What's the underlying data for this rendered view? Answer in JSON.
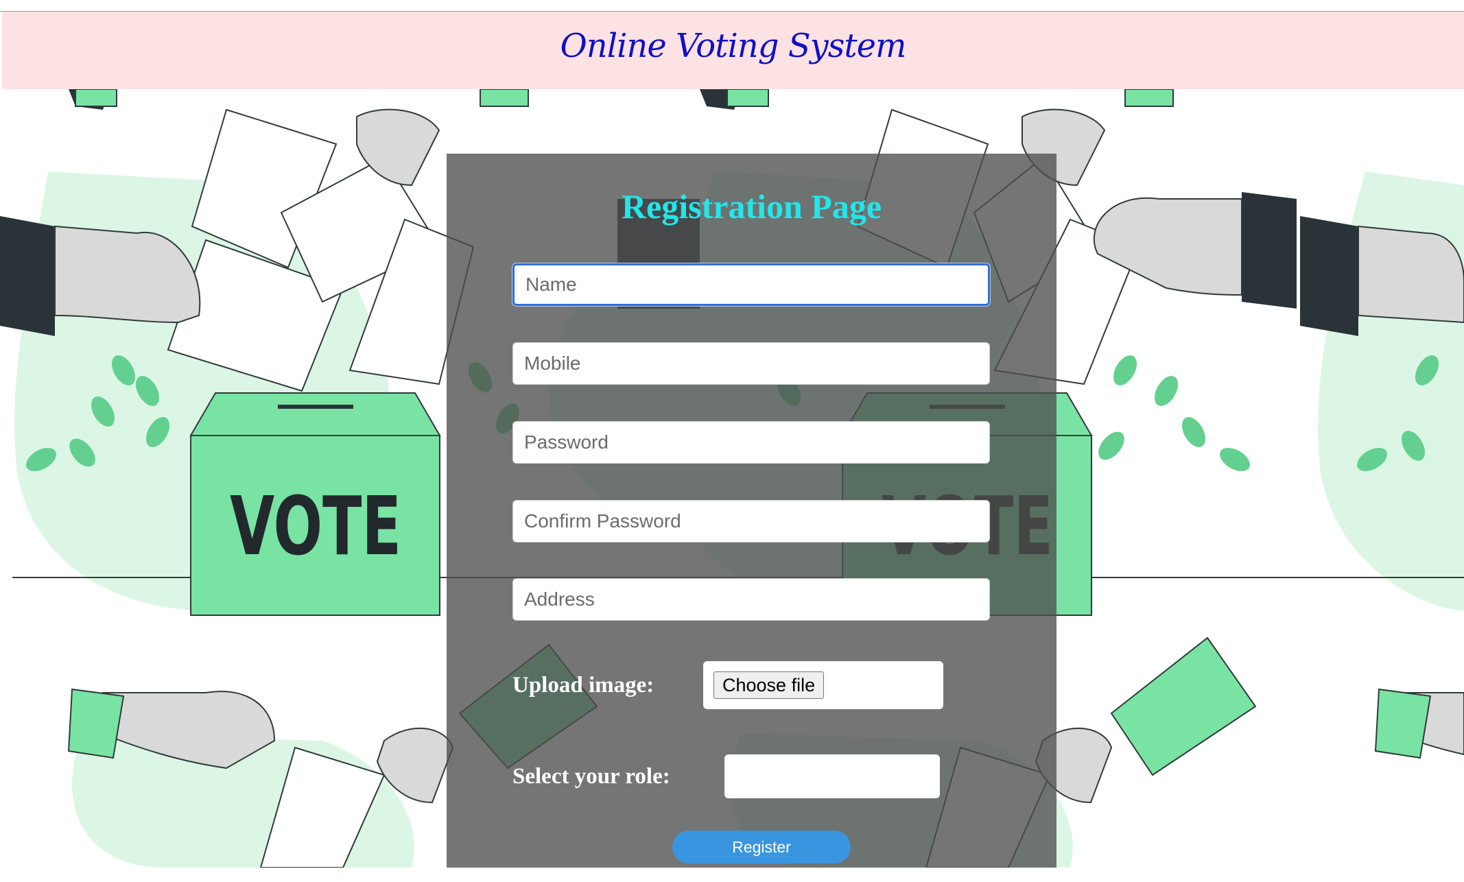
{
  "header": {
    "title": "Online Voting System"
  },
  "background": {
    "ballot_box_text": "VOTE"
  },
  "form": {
    "title": "Registration Page",
    "fields": {
      "name_placeholder": "Name",
      "mobile_placeholder": "Mobile",
      "password_placeholder": "Password",
      "confirm_password_placeholder": "Confirm Password",
      "address_placeholder": "Address"
    },
    "upload_label": "Upload image:",
    "choose_file_label": "Choose file",
    "role_label": "Select your role:",
    "role_selected": "",
    "register_label": "Register"
  },
  "colors": {
    "header_bg": "#fde2e4",
    "header_text": "#1010c8",
    "panel_title": "#22e6ea",
    "register_button": "#3a95e0",
    "illustration_green": "#79e3a4"
  }
}
